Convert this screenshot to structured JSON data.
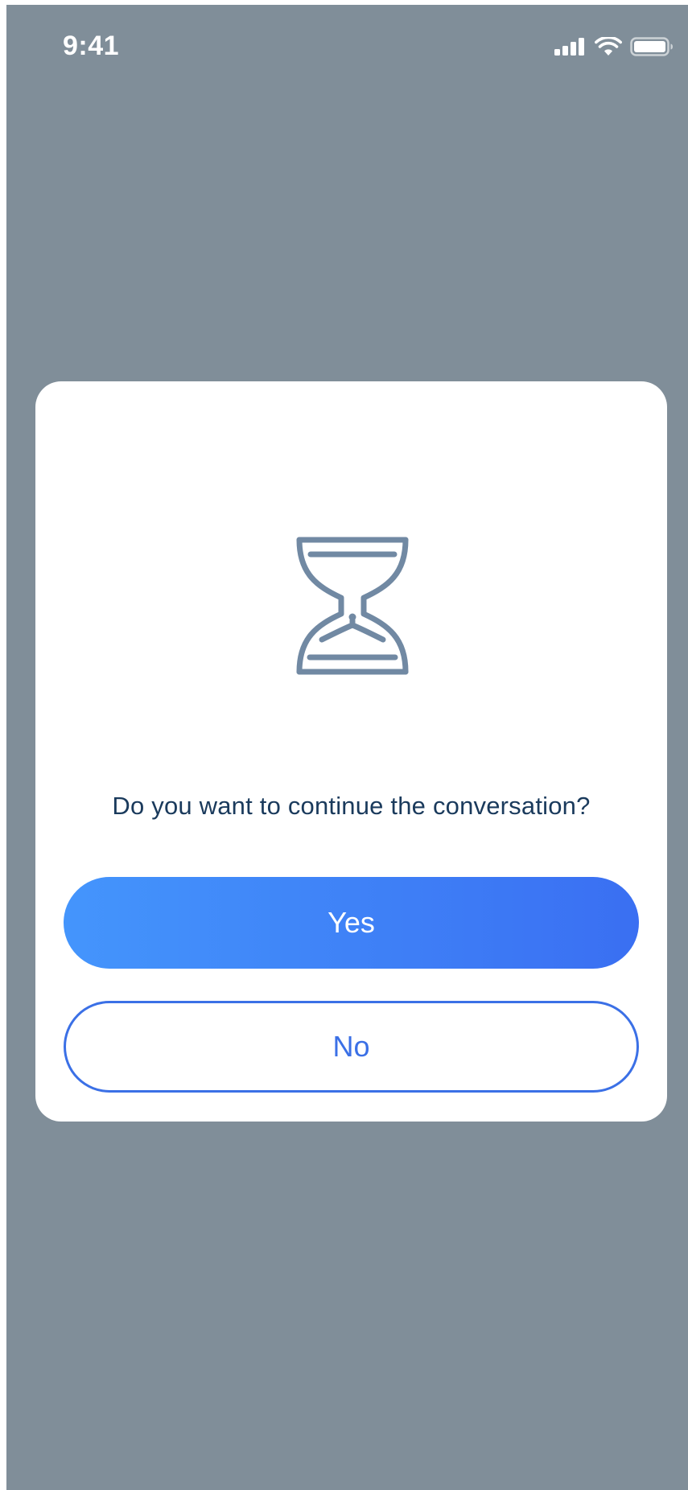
{
  "status_bar": {
    "time": "9:41",
    "icons": [
      "cellular-signal-icon",
      "wifi-icon",
      "battery-icon"
    ]
  },
  "dialog": {
    "icon": "hourglass-icon",
    "question": "Do you want to continue the conversation?",
    "yes_label": "Yes",
    "no_label": "No"
  },
  "colors": {
    "overlay": "#808e99",
    "primary_gradient_start": "#4495fc",
    "primary_gradient_end": "#3a6ff2",
    "outline": "#3b70e6",
    "question_text": "#1a3a5c",
    "icon": "#7189a3"
  }
}
